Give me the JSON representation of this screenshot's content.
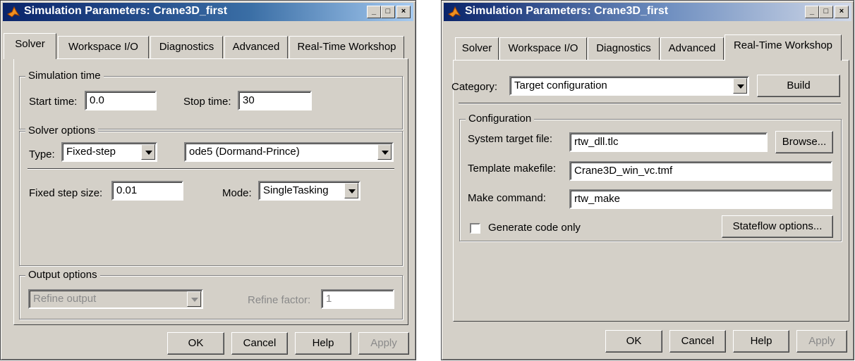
{
  "window_left": {
    "title": "Simulation Parameters: Crane3D_first",
    "tabs": [
      "Solver",
      "Workspace I/O",
      "Diagnostics",
      "Advanced",
      "Real-Time Workshop"
    ],
    "simulation_time": {
      "group": "Simulation time",
      "start_label": "Start time:",
      "start_value": "0.0",
      "stop_label": "Stop time:",
      "stop_value": "30"
    },
    "solver_options": {
      "group": "Solver options",
      "type_label": "Type:",
      "type_value": "Fixed-step",
      "solver_value": "ode5 (Dormand-Prince)",
      "step_label": "Fixed step size:",
      "step_value": "0.01",
      "mode_label": "Mode:",
      "mode_value": "SingleTasking"
    },
    "output_options": {
      "group": "Output options",
      "refine_select": "Refine output",
      "factor_label": "Refine factor:",
      "factor_value": "1"
    },
    "buttons": {
      "ok": "OK",
      "cancel": "Cancel",
      "help": "Help",
      "apply": "Apply"
    }
  },
  "window_right": {
    "title": "Simulation Parameters: Crane3D_first",
    "tabs": [
      "Solver",
      "Workspace I/O",
      "Diagnostics",
      "Advanced",
      "Real-Time Workshop"
    ],
    "category_label": "Category:",
    "category_value": "Target configuration",
    "build": "Build",
    "configuration": {
      "group": "Configuration",
      "target_label": "System target file:",
      "target_value": "rtw_dll.tlc",
      "browse": "Browse...",
      "template_label": "Template makefile:",
      "template_value": "Crane3D_win_vc.tmf",
      "make_label": "Make command:",
      "make_value": "rtw_make",
      "generate_label": "Generate code only",
      "stateflow": "Stateflow options..."
    },
    "buttons": {
      "ok": "OK",
      "cancel": "Cancel",
      "help": "Help",
      "apply": "Apply"
    }
  }
}
